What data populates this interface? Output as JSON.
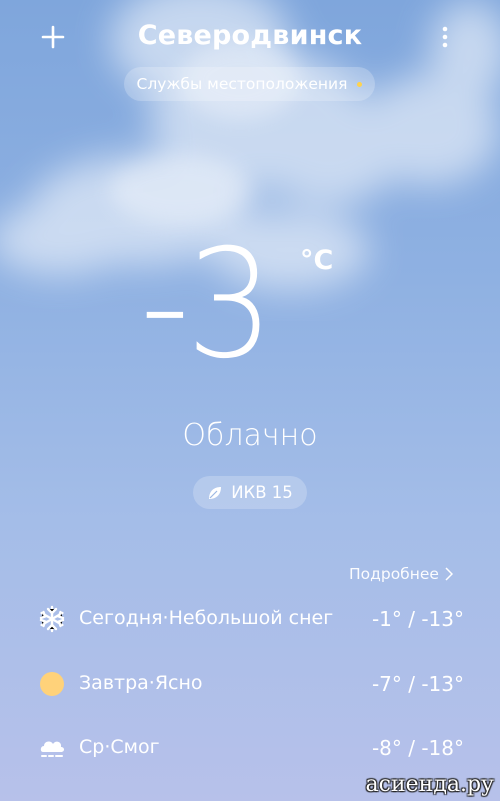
{
  "header": {
    "add_icon": "plus-icon",
    "city": "Северодвинск",
    "menu_icon": "more-vertical-icon"
  },
  "location_services": {
    "label": "Службы местоположения",
    "dot_color": "#ffd34d"
  },
  "current": {
    "temperature": "-3",
    "unit": "°C",
    "condition": "Облачно",
    "aqi_label": "ИКВ 15",
    "aqi_icon": "leaf-icon"
  },
  "details_link": {
    "label": "Подробнее",
    "icon": "chevron-right-icon"
  },
  "forecast": [
    {
      "icon": "snowflake-icon",
      "label": "Сегодня·Небольшой снег",
      "temps": "-1° / -13°"
    },
    {
      "icon": "sun-icon",
      "label": "Завтра·Ясно",
      "temps": "-7° / -13°"
    },
    {
      "icon": "smog-icon",
      "label": "Ср·Смог",
      "temps": "-8° / -18°"
    }
  ],
  "watermark": "асиенда.ру"
}
